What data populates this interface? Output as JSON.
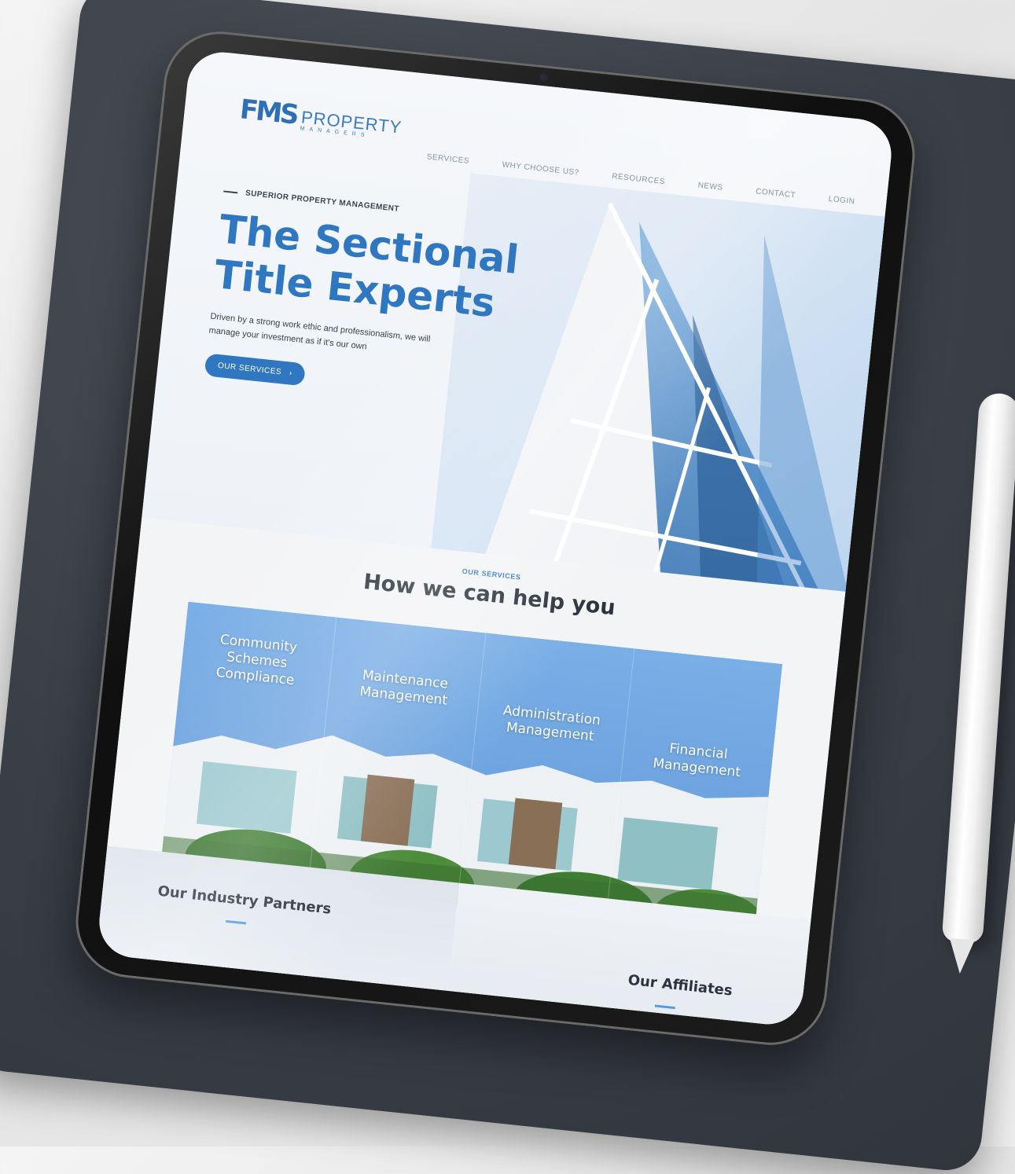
{
  "logo": {
    "mark": "FMS",
    "word": "PROPERTY",
    "sub": "MANAGERS"
  },
  "nav": {
    "items": [
      "SERVICES",
      "WHY CHOOSE US?",
      "RESOURCES",
      "NEWS",
      "CONTACT",
      "LOGIN"
    ]
  },
  "hero": {
    "eyebrow": "SUPERIOR PROPERTY MANAGEMENT",
    "title_line1": "The Sectional",
    "title_line2": "Title Experts",
    "body": "Driven by a strong work ethic and professionalism, we will manage your investment as if it's our own",
    "cta_label": "OUR SERVICES",
    "cta_arrow": "›"
  },
  "services": {
    "eyebrow": "OUR SERVICES",
    "title": "How we can help you",
    "cards": [
      {
        "line1": "Community",
        "line2": "Schemes",
        "line3": "Compliance"
      },
      {
        "line1": "Maintenance",
        "line2": "Management",
        "line3": ""
      },
      {
        "line1": "Administration",
        "line2": "Management",
        "line3": ""
      },
      {
        "line1": "Financial",
        "line2": "Management",
        "line3": ""
      }
    ]
  },
  "partners": {
    "industry_title": "Our Industry Partners",
    "affiliates_title": "Our Affiliates"
  },
  "colors": {
    "brand_blue": "#2f77c0",
    "text_dark": "#2b333d",
    "tablet_frame": "#1c1c1c",
    "mat": "#3a3f47"
  }
}
